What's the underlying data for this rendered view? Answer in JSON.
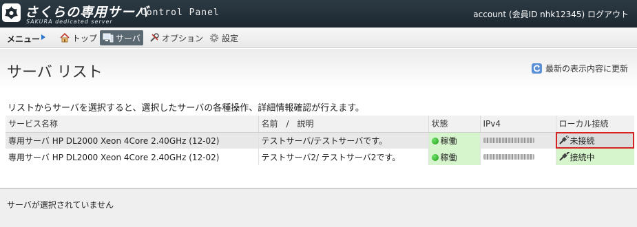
{
  "header": {
    "logo_title": "さくらの専用サーバ",
    "logo_subtitle": "SAKURA dedicated server",
    "panel_title": "Control Panel",
    "account": "account (会員ID nhk12345) ログアウト"
  },
  "menu": {
    "label": "メニュー",
    "items": [
      {
        "label": "トップ",
        "icon": "home-icon"
      },
      {
        "label": "サーバ",
        "icon": "server-icon",
        "active": true
      },
      {
        "label": "オプション",
        "icon": "tools-icon"
      },
      {
        "label": "設定",
        "icon": "gear-icon"
      }
    ]
  },
  "page": {
    "title": "サーバ リスト",
    "refresh_label": "最新の表示内容に更新",
    "description": "リストからサーバを選択すると、選択したサーバの各種操作、詳細情報確認が行えます。"
  },
  "table": {
    "headers": [
      "サービス名称",
      "名前　/　説明",
      "状態",
      "IPv4",
      "ローカル接続"
    ],
    "rows": [
      {
        "service": "専用サーバ HP DL2000 Xeon 4Core 2.40GHz (12-02)",
        "name": "テストサーバ/テストサーバです。",
        "status": "稼働",
        "ipv4": "",
        "local": "未接続"
      },
      {
        "service": "専用サーバ HP DL2000 Xeon 4Core 2.40GHz (12-02)",
        "name": "テストサーバ2/ テストサーバ2です。",
        "status": "稼働",
        "ipv4": "",
        "local": "接続中"
      }
    ]
  },
  "footer": {
    "status_text": "サーバが選択されていません"
  },
  "colors": {
    "header_bg": "#1d2830",
    "status_green": "#d6f5cc",
    "selected_outline": "#d62222",
    "menu_active": "#5a6872"
  }
}
